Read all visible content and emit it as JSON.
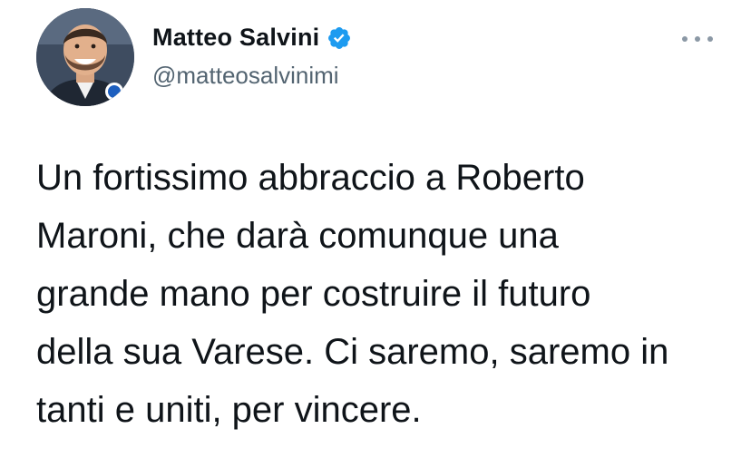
{
  "author": {
    "display_name": "Matteo Salvini",
    "handle": "@matteosalvinimi",
    "verified": true,
    "avatar_icon": "profile-photo"
  },
  "actions": {
    "more_icon": "more-horizontal-icon"
  },
  "tweet": {
    "text": "Un fortissimo abbraccio a Roberto\nMaroni, che darà comunque una\ngrande mano per costruire il futuro\ndella sua Varese. Ci saremo, saremo in\ntanti e uniti, per vincere."
  },
  "colors": {
    "verified_badge": "#1d9bf0",
    "handle_text": "#536471",
    "body_text": "#0f1419"
  }
}
